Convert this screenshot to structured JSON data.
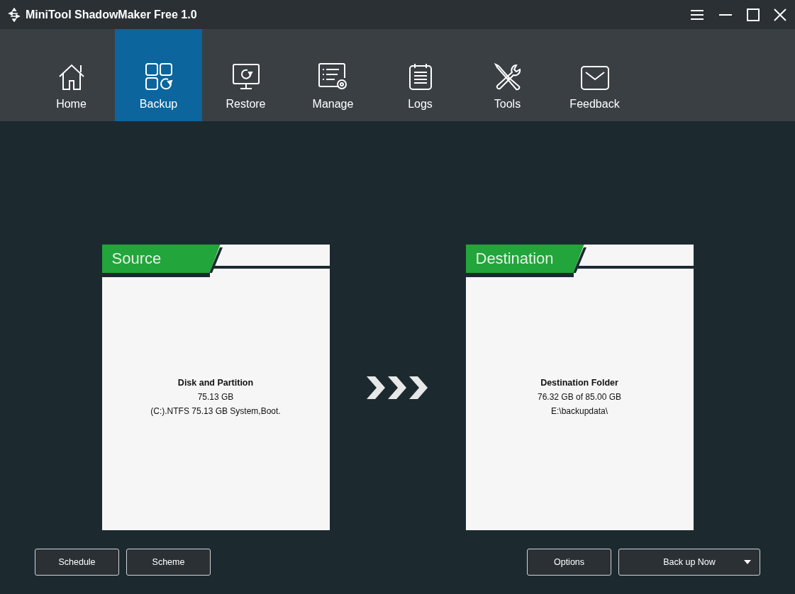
{
  "window": {
    "title": "MiniTool ShadowMaker Free 1.0"
  },
  "nav": [
    {
      "label": "Home",
      "kind": "home",
      "selected": false
    },
    {
      "label": "Backup",
      "kind": "backup",
      "selected": true
    },
    {
      "label": "Restore",
      "kind": "restore",
      "selected": false
    },
    {
      "label": "Manage",
      "kind": "manage",
      "selected": false
    },
    {
      "label": "Logs",
      "kind": "logs",
      "selected": false
    },
    {
      "label": "Tools",
      "kind": "tools",
      "selected": false
    },
    {
      "label": "Feedback",
      "kind": "feedback",
      "selected": false
    }
  ],
  "source": {
    "heading": "Source",
    "title": "Disk and Partition",
    "size": "75.13 GB",
    "detail": "(C:).NTFS 75.13 GB System,Boot."
  },
  "destination": {
    "heading": "Destination",
    "title": "Destination Folder",
    "size": "76.32 GB of 85.00 GB",
    "detail": "E:\\backupdata\\"
  },
  "buttons_left": [
    "Schedule",
    "Scheme"
  ],
  "buttons_right": {
    "options": "Options",
    "backup": "Back up Now"
  }
}
